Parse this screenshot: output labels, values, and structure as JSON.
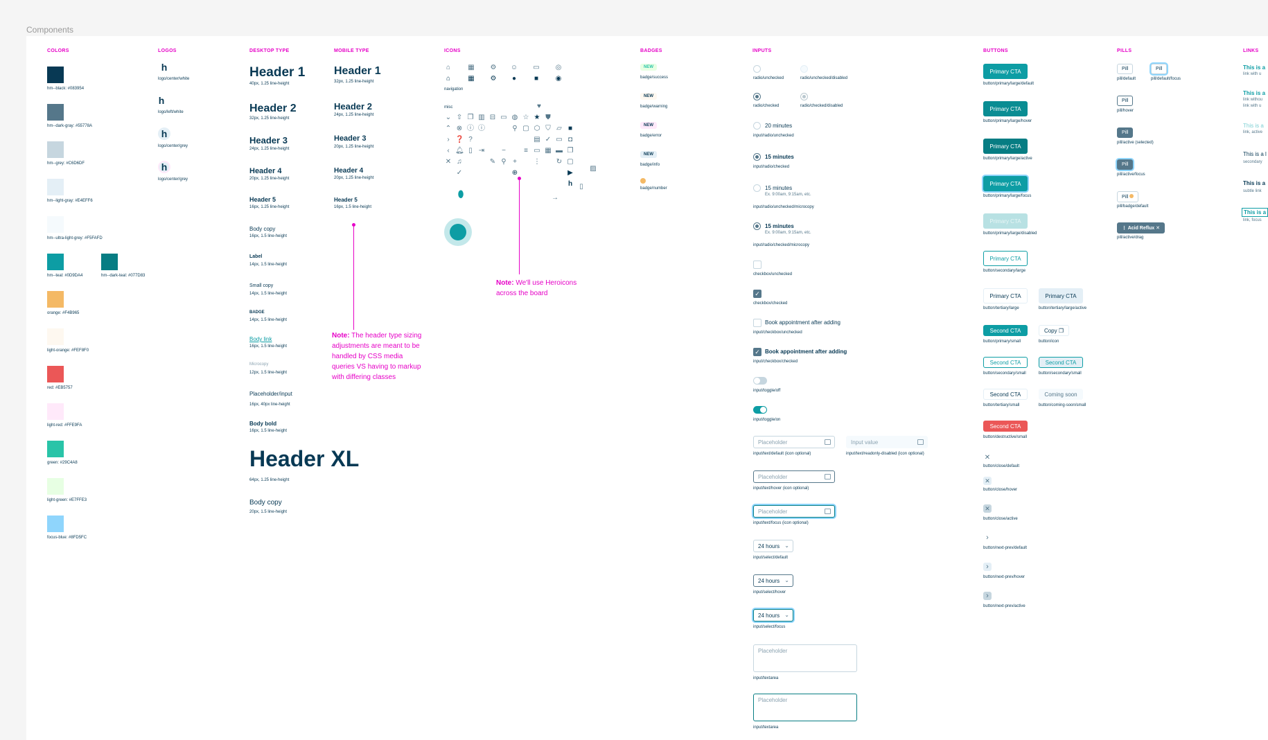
{
  "frame_title": "Components",
  "sections": {
    "colors": "COLORS",
    "logos": "LOGOS",
    "desktop_type": "DESKTOP TYPE",
    "mobile_type": "MOBILE TYPE",
    "icons": "ICONS",
    "badges": "BADGES",
    "inputs": "INPUTS",
    "buttons": "BUTTONS",
    "pills": "PILLS",
    "links": "LINKS"
  },
  "colors": [
    {
      "label": "hm--black: #083954",
      "hex": "#083954"
    },
    {
      "label": "hm--dark-gray: #55778A",
      "hex": "#55778A"
    },
    {
      "label": "hm--grey: #C6D6DF",
      "hex": "#C6D6DF"
    },
    {
      "label": "hm--light-gray: #E4EFF6",
      "hex": "#E4EFF6"
    },
    {
      "label": "hm--ultra-light-grey: #F5FAFD",
      "hex": "#F5FAFD"
    },
    {
      "label": "hm--teal: #0D9DA4",
      "hex": "#0D9DA4"
    },
    {
      "label": "hm--dark-teal: #077D83",
      "hex": "#077D83"
    },
    {
      "label": "orange: #F4B965",
      "hex": "#F4B965"
    },
    {
      "label": "light-orange: #FEF8F0",
      "hex": "#FEF8F0"
    },
    {
      "label": "red: #EB5757",
      "hex": "#EB5757"
    },
    {
      "label": "light-red: #FFE9FA",
      "hex": "#FFE9FA"
    },
    {
      "label": "green: #29C4A8",
      "hex": "#29C4A8"
    },
    {
      "label": "light-green: #E7FFE3",
      "hex": "#E7FFE3"
    },
    {
      "label": "focus-blue: #8FD5FC",
      "hex": "#8FD5FC"
    }
  ],
  "logos": [
    {
      "glyph": "h",
      "label": "logo/center/white"
    },
    {
      "glyph": "h",
      "label": "logo/left/white"
    },
    {
      "glyph": "h",
      "label": "logo/center/grey"
    },
    {
      "glyph": "h",
      "label": "logo/center/grey"
    }
  ],
  "desktop_type": [
    {
      "text": "Header 1",
      "spec": "40px, 1.25 line-height"
    },
    {
      "text": "Header 2",
      "spec": "32px, 1.25 line-height"
    },
    {
      "text": "Header 3",
      "spec": "24px, 1.25 line-height"
    },
    {
      "text": "Header 4",
      "spec": "20px, 1.25 line-height"
    },
    {
      "text": "Header 5",
      "spec": "16px, 1.25 line-height"
    },
    {
      "text": "Body copy",
      "spec": "16px, 1.5 line-height"
    },
    {
      "text": "Label",
      "spec": "14px, 1.5 line-height"
    },
    {
      "text": "Small copy",
      "spec": "14px, 1.5 line-height"
    },
    {
      "text": "BADGE",
      "spec": "14px, 1.5 line-height"
    },
    {
      "text": "Body link",
      "spec": "16px, 1.5 line-height"
    },
    {
      "text": "Microcopy",
      "spec": "12px, 1.5 line-height"
    },
    {
      "text": "Placeholder/input",
      "spec": "16px, 40px line-height"
    },
    {
      "text": "Body bold",
      "spec": "16px, 1.5 line-height"
    },
    {
      "text": "Header XL",
      "spec": "64px, 1.25 line-height"
    },
    {
      "text": "Body copy",
      "spec": "20px, 1.5 line-height"
    }
  ],
  "mobile_type": [
    {
      "text": "Header 1",
      "spec": "32px, 1.25 line-height"
    },
    {
      "text": "Header 2",
      "spec": "24px, 1.25 line-height"
    },
    {
      "text": "Header 3",
      "spec": "20px, 1.25 line-height"
    },
    {
      "text": "Header 4",
      "spec": "20px, 1.25 line-height"
    },
    {
      "text": "Header 5",
      "spec": "16px, 1.5 line-height"
    }
  ],
  "type_note": {
    "lead": "Note:",
    "text": "The header type sizing adjustments are meant to be handled by CSS media queries VS having to markup with differing classes"
  },
  "icons_note": {
    "lead": "Note:",
    "text": "We'll use Heroicons across the board"
  },
  "icon_groups": {
    "navigation": "navigation",
    "misc": "misc"
  },
  "badges": [
    {
      "text": "NEW",
      "label": "badge/success",
      "bg": "#E7FFE3",
      "fg": "#29C4A8"
    },
    {
      "text": "NEW",
      "label": "badge/warning",
      "bg": "#FEF8F0",
      "fg": "#083954"
    },
    {
      "text": "NEW",
      "label": "badge/error",
      "bg": "#FFE9FA",
      "fg": "#083954"
    },
    {
      "text": "NEW",
      "label": "badge/info",
      "bg": "#E4EFF6",
      "fg": "#083954"
    },
    {
      "text": "",
      "label": "badge/number",
      "bg": "#F4B965",
      "fg": "#ffffff"
    }
  ],
  "inputs": {
    "radio_unchecked": "radio/unchecked",
    "radio_unchecked_disabled": "radio/unchecked/disabled",
    "radio_checked": "radio/checked",
    "radio_checked_disabled": "radio/checked/disabled",
    "option_20": "20 minutes",
    "input_radio_unchecked": "input/radio/unchecked",
    "option_15": "15 minutes",
    "input_radio_checked": "input/radio/checked",
    "option_15_micro": "15 minutes",
    "microcopy": "Ex. 9:00am, 9:15am, etc.",
    "input_radio_unchecked_micro": "input/radio/unchecked/microcopy",
    "input_radio_checked_micro": "input/radio/checked/microcopy",
    "checkbox_unchecked": "checkbox/unchecked",
    "checkbox_checked": "checkbox/checked",
    "book_label": "Book appointment after adding",
    "input_checkbox_unchecked": "input/checkbox/unchecked",
    "input_checkbox_checked": "input/checkbox/checked",
    "toggle_off": "input/toggle/off",
    "toggle_on": "input/toggle/on",
    "placeholder": "Placeholder",
    "input_value": "Input value",
    "text_default": "input/text/default (icon optional)",
    "text_readonly": "input/text/readonly-disabled (icon optional)",
    "text_hover": "input/text/hover (icon optional)",
    "text_focus": "input/text/focus (icon optional)",
    "select_value": "24 hours",
    "select_default": "input/select/default",
    "select_hover": "input/select/hover",
    "select_focus": "input/select/focus",
    "textarea": "input/textarea"
  },
  "buttons": {
    "primary_cta": "Primary CTA",
    "second_cta": "Second CTA",
    "copy": "Copy",
    "coming_soon": "Coming soon",
    "labels": {
      "p_default": "button/primary/large/default",
      "p_hover": "button/primary/large/hover",
      "p_active": "button/primary/large/active",
      "p_focus": "button/primary/large/focus",
      "p_disabled": "button/primary/large/disabled",
      "secondary_large": "button/secondary/large",
      "tertiary_large": "button/tertiary/large",
      "tertiary_large_active": "button/tertiary/large/active",
      "primary_small": "button/primary/small",
      "icon": "button/icon",
      "secondary_small": "button/secondary/small",
      "secondary_small_2": "button/secondary/small",
      "tertiary_small": "button/tertiary/small",
      "coming_soon_small": "button/coming-soon/small",
      "destructive_small": "button/destructive/small",
      "close_default": "button/close/default",
      "close_hover": "button/close/hover",
      "close_active": "button/close/active",
      "np_default": "button/next-prev/default",
      "np_hover": "button/next-prev/hover",
      "np_active": "button/next-prev/active"
    }
  },
  "pills": {
    "pill": "Pill",
    "acid_reflux": "Acid Reflux",
    "labels": {
      "default": "pill/default",
      "default_focus": "pill/default/focus",
      "hover": "pill/hover",
      "active_selected": "pill/active (selected)",
      "active_focus": "pill/active/focus",
      "badge_default": "pill/badge/default",
      "active_drag": "pill/active/drag"
    }
  },
  "links": [
    {
      "text": "This is a",
      "sub": "link with u"
    },
    {
      "text": "This is a",
      "sub": "link withou"
    },
    {
      "text": "",
      "sub": "link with u"
    },
    {
      "text": "This is a",
      "sub": "link, active"
    },
    {
      "text": "This is a l",
      "sub": "secondary"
    },
    {
      "text": "This is a",
      "sub": "subtle link"
    },
    {
      "text": "This is a",
      "sub": "link, focus"
    }
  ]
}
